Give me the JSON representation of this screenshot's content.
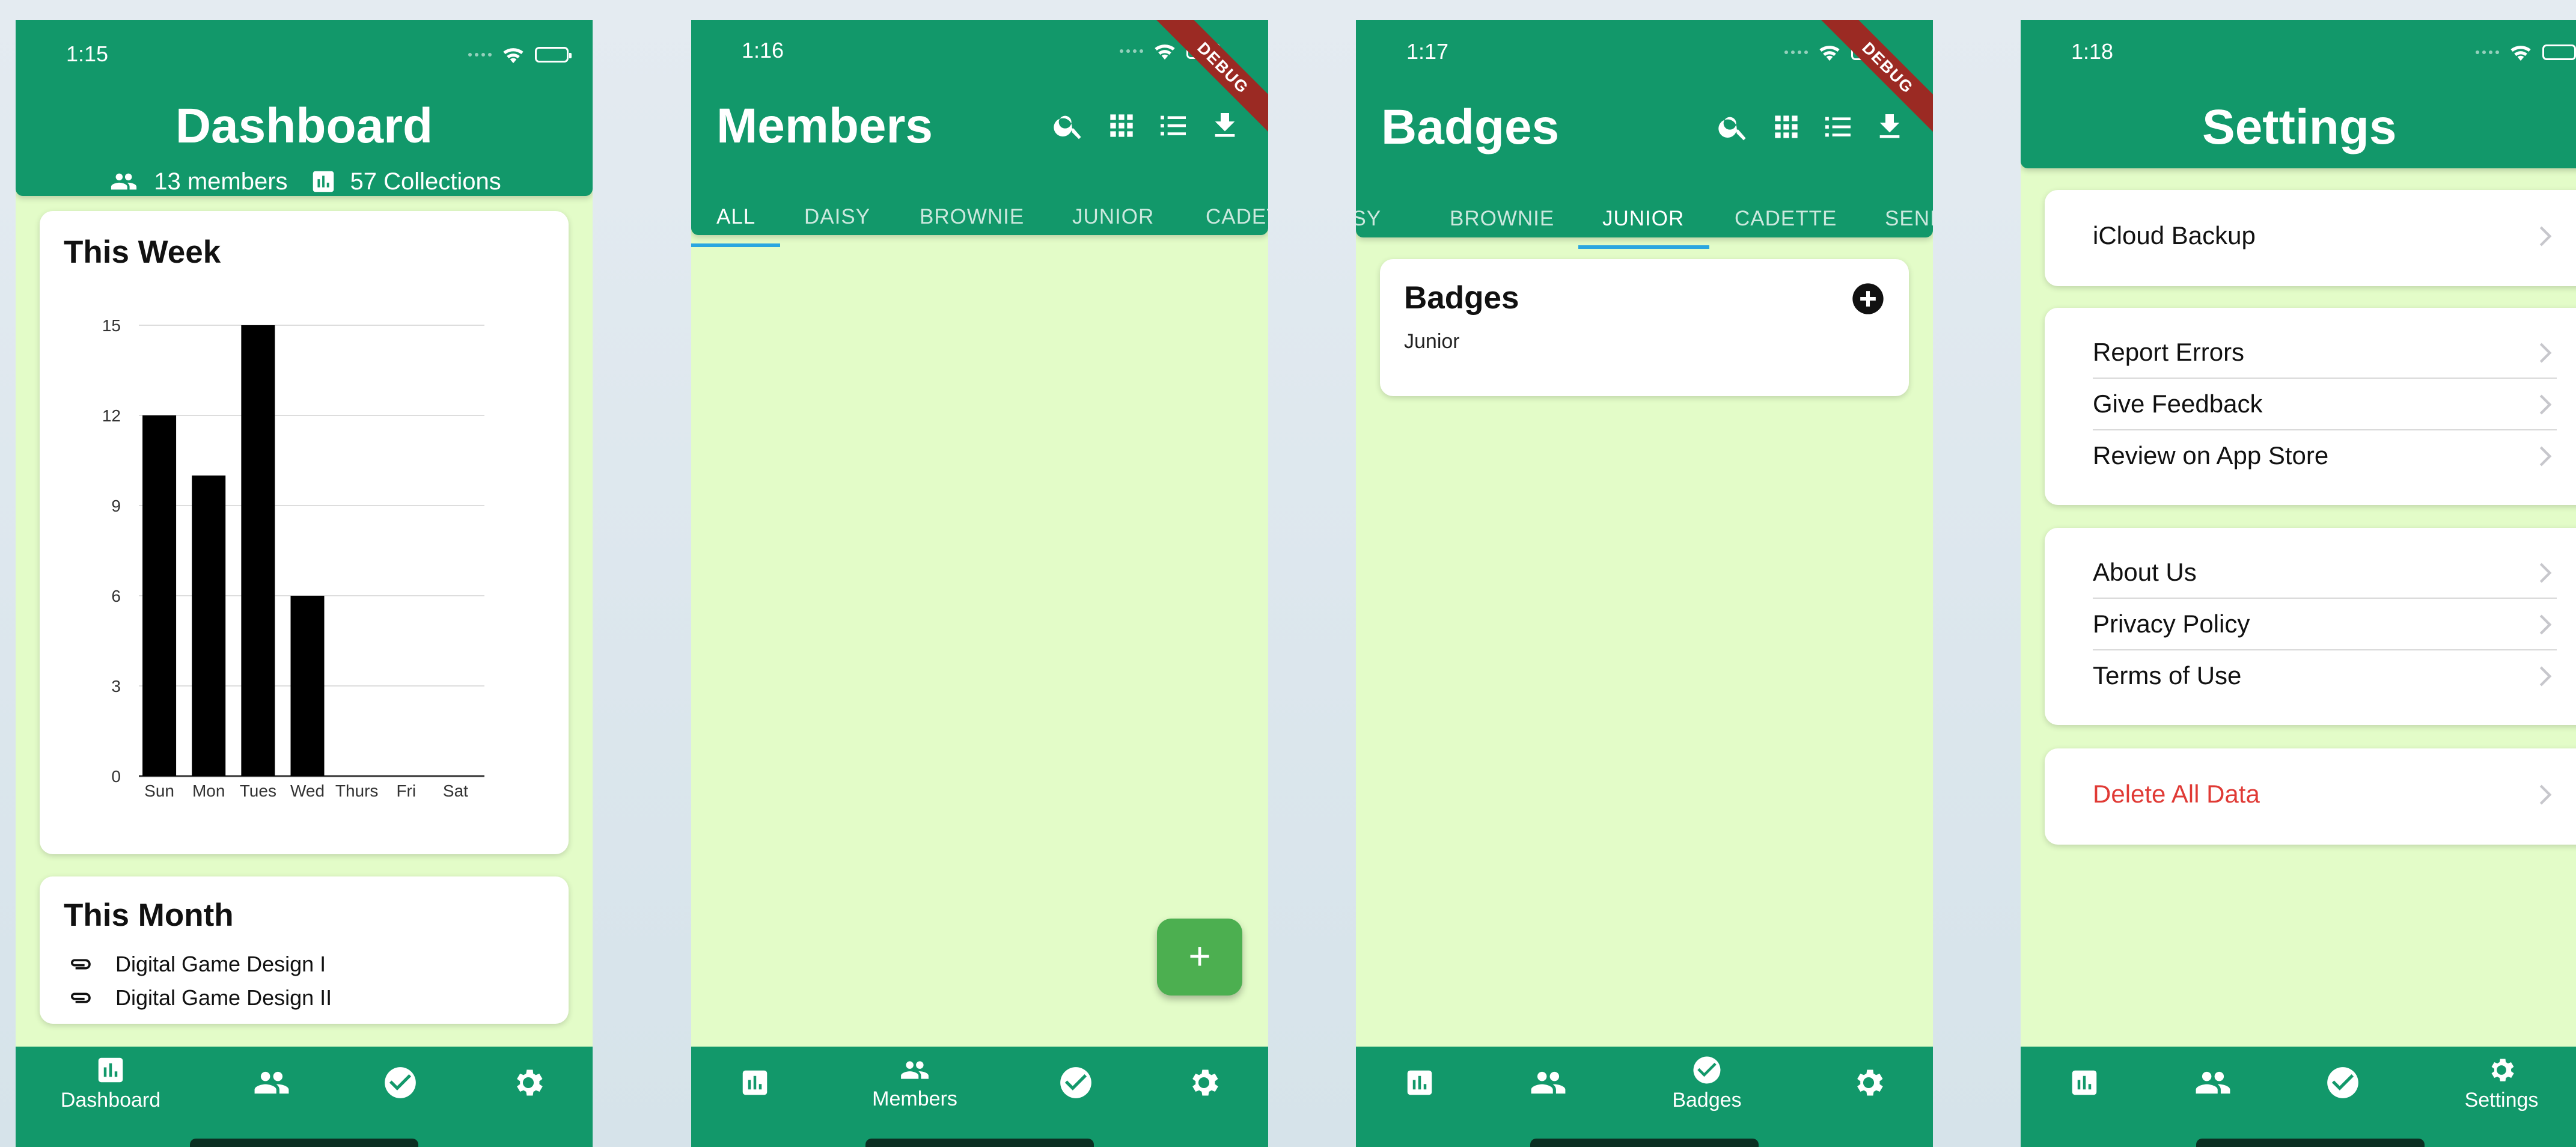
{
  "colors": {
    "primary": "#12986a",
    "background": "#e3fcc8",
    "danger": "#e03a35",
    "tab_indicator": "#2aa6e0",
    "fab": "#4caf50",
    "bars": "#000000"
  },
  "screens": {
    "dashboard": {
      "time": "1:15",
      "title": "Dashboard",
      "members_count": "13 members",
      "collections_count": "57 Collections",
      "week_card_title": "This Week",
      "month_card_title": "This Month",
      "month_items": [
        "Digital Game Design I",
        "Digital Game Design II"
      ]
    },
    "members": {
      "time": "1:16",
      "title": "Members",
      "tabs": [
        "ALL",
        "DAISY",
        "BROWNIE",
        "JUNIOR",
        "CADETTE"
      ],
      "active_tab": "ALL",
      "debug_label": "DEBUG",
      "fab_label": "+"
    },
    "badges": {
      "time": "1:17",
      "title": "Badges",
      "tabs": [
        "DAISY",
        "BROWNIE",
        "JUNIOR",
        "CADETTE",
        "SENIOR"
      ],
      "active_tab": "JUNIOR",
      "debug_label": "DEBUG",
      "card_title": "Badges",
      "card_subtitle": "Junior"
    },
    "settings": {
      "time": "1:18",
      "title": "Settings",
      "groups": [
        [
          "iCloud Backup"
        ],
        [
          "Report Errors",
          "Give Feedback",
          "Review on App Store"
        ],
        [
          "About Us",
          "Privacy Policy",
          "Terms of Use"
        ],
        [
          "Delete All Data"
        ]
      ]
    }
  },
  "nav": {
    "dashboard_label": "Dashboard",
    "members_label": "Members",
    "badges_label": "Badges",
    "settings_label": "Settings",
    "icons": [
      "chart-icon",
      "people-icon",
      "check-circle-icon",
      "gear-icon"
    ]
  },
  "chart_data": {
    "type": "bar",
    "title": "This Week",
    "categories": [
      "Sun",
      "Mon",
      "Tues",
      "Wed",
      "Thurs",
      "Fri",
      "Sat"
    ],
    "values": [
      12,
      10,
      15,
      6,
      0,
      0,
      0
    ],
    "ylim": [
      0,
      15
    ],
    "yticks": [
      0,
      3,
      6,
      9,
      12,
      15
    ],
    "grid": true,
    "xlabel": "",
    "ylabel": ""
  }
}
